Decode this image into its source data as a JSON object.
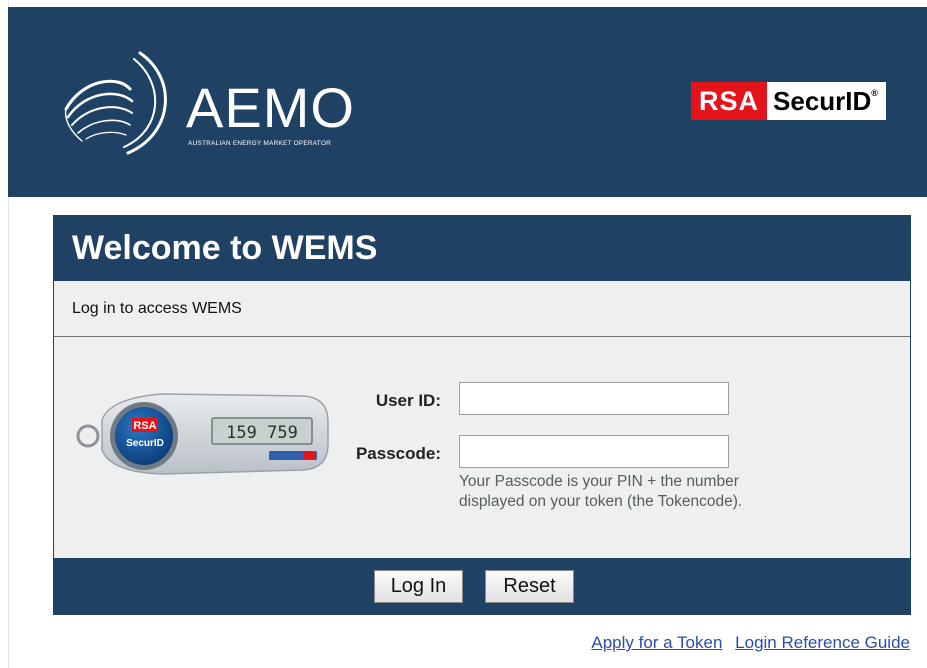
{
  "brand": {
    "aemo_name": "AEMO",
    "aemo_tagline": "AUSTRALIAN ENERGY MARKET OPERATOR",
    "rsa_left": "RSA",
    "rsa_right": "SecurID",
    "rsa_mark": "®"
  },
  "panel": {
    "title": "Welcome to WEMS",
    "subtitle": "Log in to access WEMS"
  },
  "token": {
    "brand_top": "RSA",
    "brand_bottom": "SecurID",
    "display_code": "159 759"
  },
  "form": {
    "user_id_label": "User ID:",
    "user_id_value": "",
    "passcode_label": "Passcode:",
    "passcode_value": "",
    "passcode_hint": "Your Passcode is your PIN + the number displayed on your token (the Tokencode)."
  },
  "buttons": {
    "login": "Log In",
    "reset": "Reset"
  },
  "links": {
    "apply_token": "Apply for a Token",
    "reference_guide": "Login Reference Guide"
  },
  "colors": {
    "header_bg": "#1f4264",
    "rsa_red": "#e4141b",
    "link": "#2c4ea7"
  }
}
